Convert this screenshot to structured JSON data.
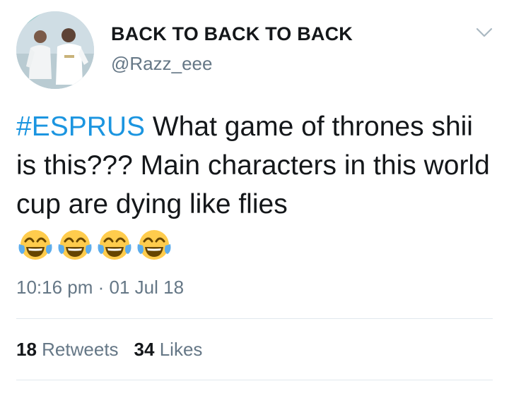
{
  "tweet": {
    "display_name": "BACK TO BACK TO BACK",
    "handle": "@Razz_eee",
    "hashtag": "#ESPRUS",
    "text_after_hashtag": " What game of thrones shii is this??? Main characters in this world cup are dying like flies",
    "emoji_name": "face-with-tears-of-joy",
    "emoji_count": 4,
    "timestamp": "10:16 pm · 01 Jul 18",
    "retweets_count": "18",
    "retweets_label": "Retweets",
    "likes_count": "34",
    "likes_label": "Likes"
  },
  "colors": {
    "link": "#1b95e0",
    "secondary_text": "#657786",
    "primary_text": "#14171a",
    "divider": "#e1e8ed"
  },
  "icons": {
    "menu": "chevron-down-icon",
    "avatar": "profile-avatar"
  }
}
